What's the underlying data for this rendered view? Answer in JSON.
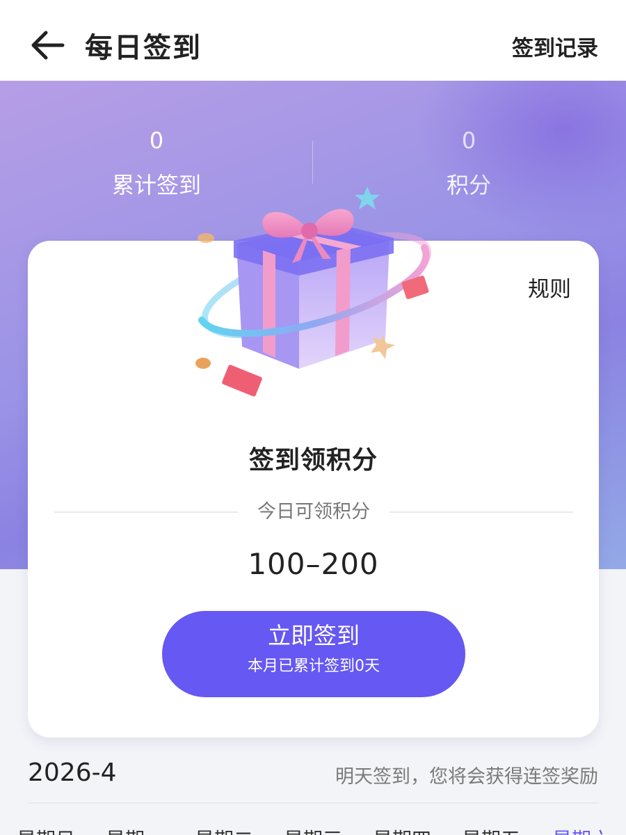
{
  "header": {
    "title": "每日签到",
    "record_link": "签到记录"
  },
  "stats": {
    "total_signins": {
      "value": "0",
      "label": "累计签到"
    },
    "points": {
      "value": "0",
      "label": "积分"
    }
  },
  "card": {
    "rules_link": "规则",
    "title": "签到领积分",
    "today_points_label": "今日可领积分",
    "points_range": "100–200",
    "signin_button": {
      "label": "立即签到",
      "subtext": "本月已累计签到0天"
    }
  },
  "calendar": {
    "month": "2026-4",
    "streak_tip": "明天签到，您将会获得连签奖励",
    "weekdays": [
      "星期日",
      "星期一",
      "星期二",
      "星期三",
      "星期四",
      "星期五",
      "星期六"
    ],
    "active_weekday": "星期六"
  },
  "colors": {
    "accent": "#6658f2",
    "hero_start": "#b69ee6",
    "hero_end": "#93a9e6"
  },
  "icons": {
    "back": "arrow-left-icon",
    "gift": "gift-box-illustration"
  }
}
